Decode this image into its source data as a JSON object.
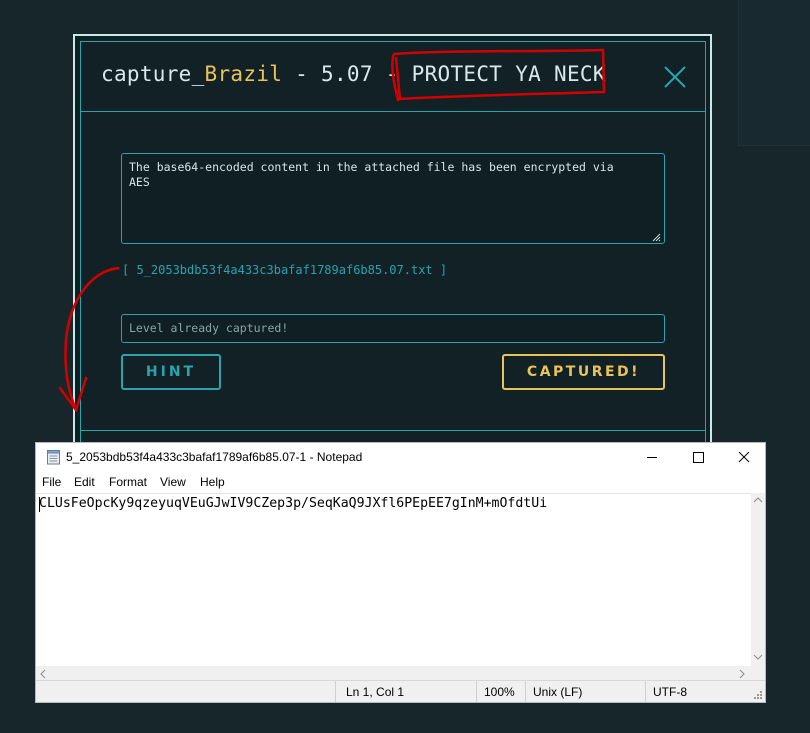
{
  "ctf_modal": {
    "title_prefix": "capture_",
    "title_country": "Brazil",
    "title_suffix": " - 5.07 - PROTECT YA NECK",
    "description": "The base64-encoded content in the attached file has been encrypted via\nAES",
    "attachment": "[ 5_2053bdb53f4a433c3bafaf1789af6b85.07.txt ]",
    "flag_placeholder": "Level already captured!",
    "hint_label": "HINT",
    "captured_label": "CAPTURED!"
  },
  "notepad": {
    "title": "5_2053bdb53f4a433c3bafaf1789af6b85.07-1 - Notepad",
    "menu": [
      "File",
      "Edit",
      "Format",
      "View",
      "Help"
    ],
    "content": "CLUsFeOpcKy9qzeyuqVEuGJwIV9CZep3p/SeqKaQ9JXfl6PEpEE7gInM+mOfdtUi",
    "status": {
      "position": "Ln 1, Col 1",
      "zoom": "100%",
      "line_endings": "Unix (LF)",
      "encoding": "UTF-8"
    }
  },
  "colors": {
    "background": "#17262b",
    "accent_teal": "#2aa3ad",
    "accent_yellow": "#e8c45a",
    "annotation_red": "#d40000"
  }
}
